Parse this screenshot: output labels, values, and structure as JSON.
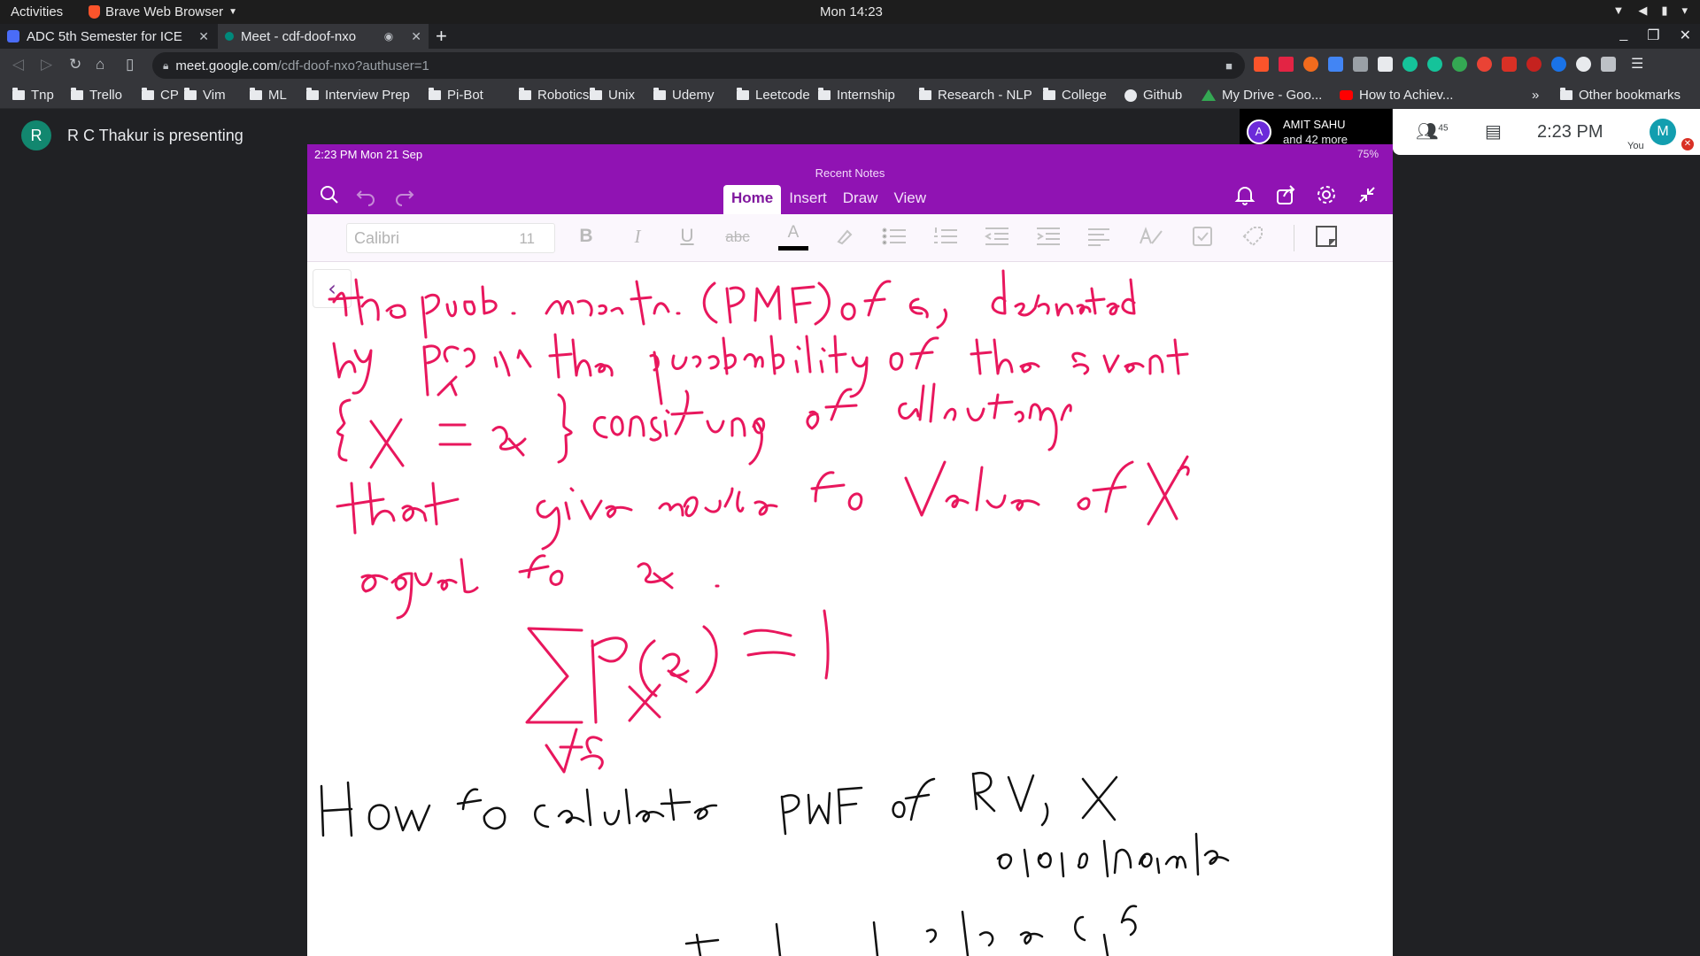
{
  "system_bar": {
    "activities": "Activities",
    "app_name": "Brave Web Browser",
    "clock": "Mon 14:23"
  },
  "browser": {
    "tabs": [
      {
        "title": "ADC 5th Semester for ICE y",
        "active": false
      },
      {
        "title": "Meet - cdf-doof-nxo",
        "active": true
      }
    ],
    "url_host": "meet.google.com",
    "url_path": "/cdf-doof-nxo?authuser=1",
    "bookmarks": [
      {
        "label": "Tnp",
        "icon": "folder-icon"
      },
      {
        "label": "Trello",
        "icon": "folder-icon"
      },
      {
        "label": "CP",
        "icon": "folder-icon"
      },
      {
        "label": "Vim",
        "icon": "folder-icon"
      },
      {
        "label": "ML",
        "icon": "folder-icon"
      },
      {
        "label": "Interview Prep",
        "icon": "folder-icon"
      },
      {
        "label": "Pi-Bot",
        "icon": "folder-icon"
      },
      {
        "label": "Robotics",
        "icon": "folder-icon"
      },
      {
        "label": "Unix",
        "icon": "folder-icon"
      },
      {
        "label": "Udemy",
        "icon": "folder-icon"
      },
      {
        "label": "Leetcode",
        "icon": "folder-icon"
      },
      {
        "label": "Internship",
        "icon": "folder-icon"
      },
      {
        "label": "Research - NLP",
        "icon": "folder-icon"
      },
      {
        "label": "College",
        "icon": "folder-icon"
      },
      {
        "label": "Github",
        "icon": "github-icon"
      },
      {
        "label": "My Drive - Goo...",
        "icon": "google-drive-icon"
      },
      {
        "label": "How to Achiev...",
        "icon": "youtube-icon"
      }
    ],
    "overflow": "»",
    "other_bookmarks": "Other bookmarks"
  },
  "meet": {
    "presenter_initial": "R",
    "presenting_text": "R C Thakur is presenting",
    "participant_initial": "A",
    "participant_name": "AMIT SAHU",
    "participant_more": "and 42 more",
    "people_count": "45",
    "time": "2:23 PM",
    "self_initial": "M",
    "self_label": "You"
  },
  "onenote": {
    "status_time": "2:23 PM   Mon 21 Sep",
    "status_battery": "75%",
    "recent_notes": "Recent Notes",
    "ribbon_tabs": [
      "Home",
      "Insert",
      "Draw",
      "View"
    ],
    "active_tab": "Home",
    "font_name": "Calibri",
    "font_size": "11",
    "bold": "B",
    "italic": "I",
    "underline": "U",
    "strike": "abc",
    "font_color": "A",
    "collapse_glyph": "‹"
  },
  "colors": {
    "onenote_purple": "#9013b3",
    "ink": "#e8175d",
    "ink_black": "#111111",
    "meet_bg": "#202124"
  }
}
